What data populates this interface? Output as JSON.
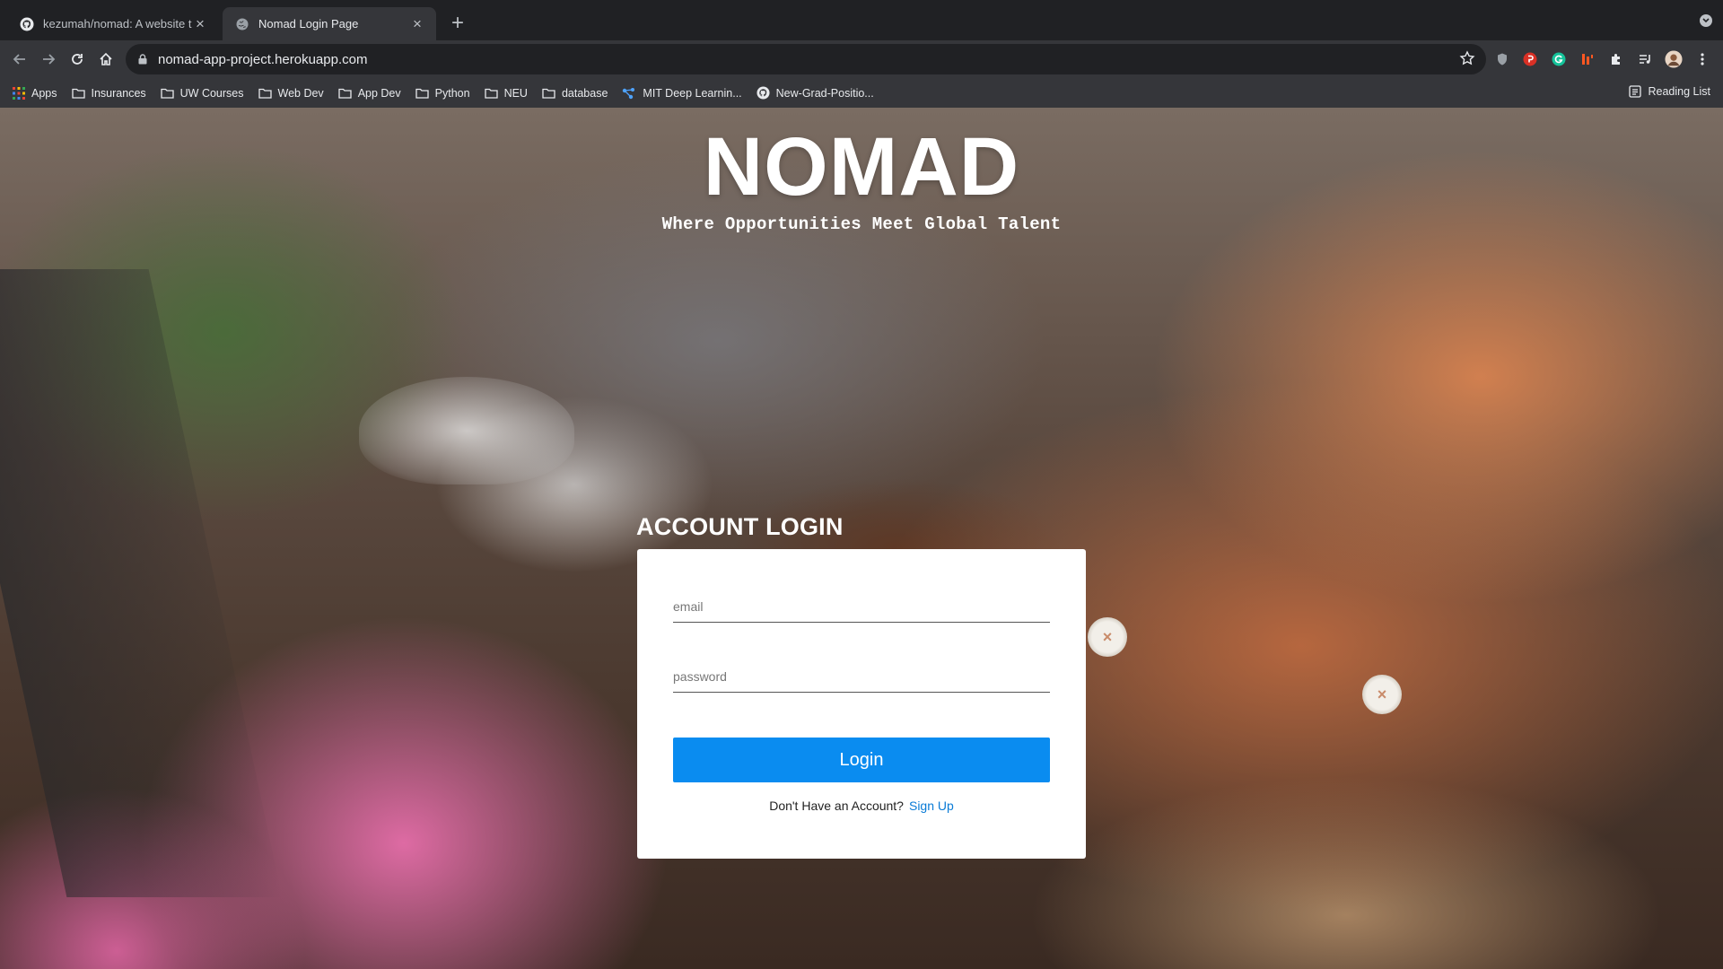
{
  "browser": {
    "tabs": [
      {
        "title": "kezumah/nomad: A website to",
        "favicon": "github-icon",
        "active": false
      },
      {
        "title": "Nomad Login Page",
        "favicon": "globe-icon",
        "active": true
      }
    ],
    "url": "nomad-app-project.herokuapp.com",
    "bookmarks": [
      {
        "label": "Apps",
        "icon": "apps-grid-icon"
      },
      {
        "label": "Insurances",
        "icon": "folder-icon"
      },
      {
        "label": "UW Courses",
        "icon": "folder-icon"
      },
      {
        "label": "Web Dev",
        "icon": "folder-icon"
      },
      {
        "label": "App Dev",
        "icon": "folder-icon"
      },
      {
        "label": "Python",
        "icon": "folder-icon"
      },
      {
        "label": "NEU",
        "icon": "folder-icon"
      },
      {
        "label": "database",
        "icon": "folder-icon"
      },
      {
        "label": "MIT Deep Learnin...",
        "icon": "share-nodes-icon"
      },
      {
        "label": "New-Grad-Positio...",
        "icon": "github-icon"
      }
    ],
    "reading_list": "Reading List"
  },
  "page": {
    "brand": "NOMAD",
    "tagline": "Where Opportunities Meet Global Talent",
    "login_heading": "ACCOUNT LOGIN",
    "email_placeholder": "email",
    "password_placeholder": "password",
    "login_label": "Login",
    "signup_prompt": "Don't Have an Account?",
    "signup_link": "Sign Up"
  },
  "colors": {
    "primary_button": "#0a8cf0",
    "link": "#0a7bd6",
    "chrome_dark": "#202124",
    "chrome_toolbar": "#35363a"
  }
}
